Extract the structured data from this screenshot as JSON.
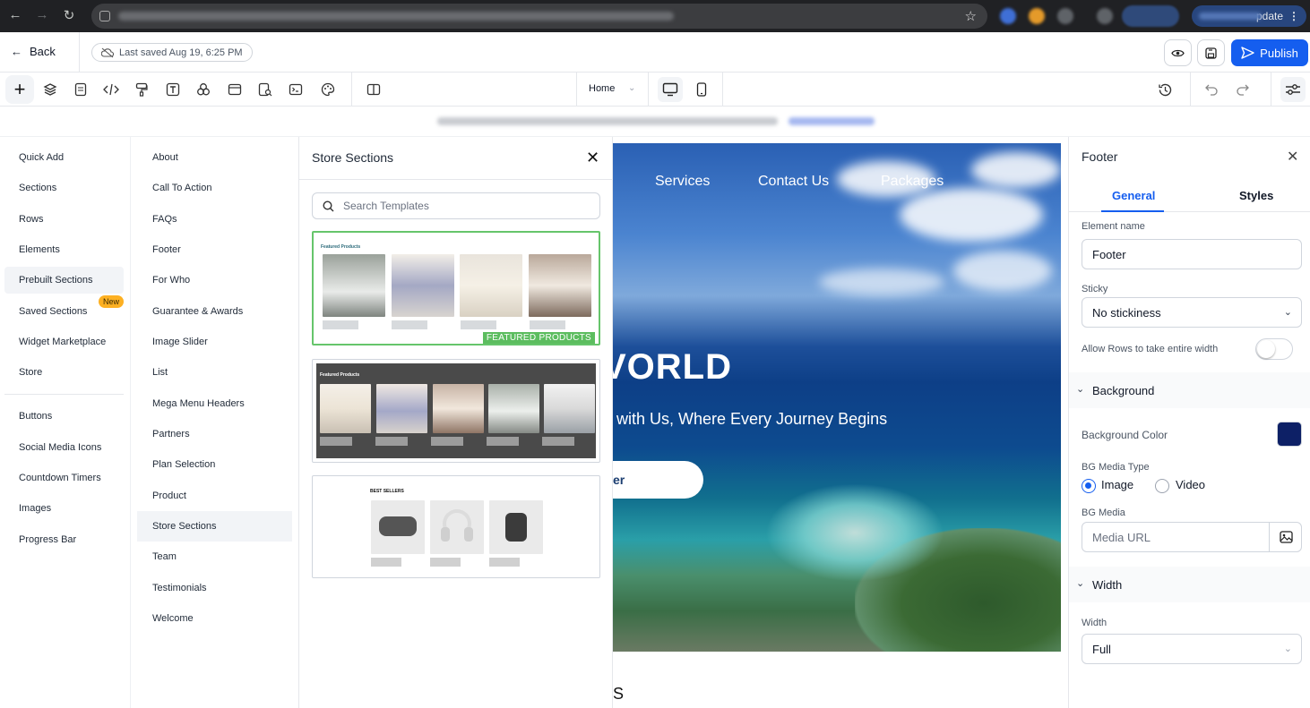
{
  "browser": {
    "relaunch_label": "pdate"
  },
  "topbar": {
    "back_label": "Back",
    "saved_label": "Last saved Aug 19, 6:25 PM",
    "publish_label": "Publish"
  },
  "toolbar": {
    "page_select": "Home"
  },
  "col1": {
    "items": [
      "Quick Add",
      "Sections",
      "Rows",
      "Elements",
      "Prebuilt Sections",
      "Saved Sections",
      "Widget Marketplace",
      "Store",
      "Buttons",
      "Social Media Icons",
      "Countdown Timers",
      "Images",
      "Progress Bar"
    ],
    "new_badge": "New"
  },
  "col2": {
    "items": [
      "About",
      "Call To Action",
      "FAQs",
      "Footer",
      "For Who",
      "Guarantee & Awards",
      "Image Slider",
      "List",
      "Mega Menu Headers",
      "Partners",
      "Plan Selection",
      "Product",
      "Store Sections",
      "Team",
      "Testimonials",
      "Welcome"
    ]
  },
  "store": {
    "title": "Store Sections",
    "search_placeholder": "Search Templates",
    "card1_title": "Featured Products",
    "card1_badge": "FEATURED PRODUCTS",
    "card2_title": "Featured Products",
    "card3_title": "BEST SELLERS"
  },
  "canvas": {
    "nav": [
      "Services",
      "Contact Us",
      "Packages"
    ],
    "headline": "VORLD",
    "subline": "with Us, Where Every Journey Begins",
    "cta": "er",
    "fragment": "S"
  },
  "props": {
    "title": "Footer",
    "tab_general": "General",
    "tab_styles": "Styles",
    "element_name_label": "Element name",
    "element_name_value": "Footer",
    "sticky_label": "Sticky",
    "sticky_value": "No stickiness",
    "allow_rows_label": "Allow Rows to take entire width",
    "background_section": "Background",
    "bg_color_label": "Background Color",
    "bg_color": "#0d2066",
    "bg_media_type_label": "BG Media Type",
    "opt_image": "Image",
    "opt_video": "Video",
    "bg_media_label": "BG Media",
    "media_placeholder": "Media URL",
    "width_section": "Width",
    "width_label": "Width",
    "width_value": "Full"
  }
}
